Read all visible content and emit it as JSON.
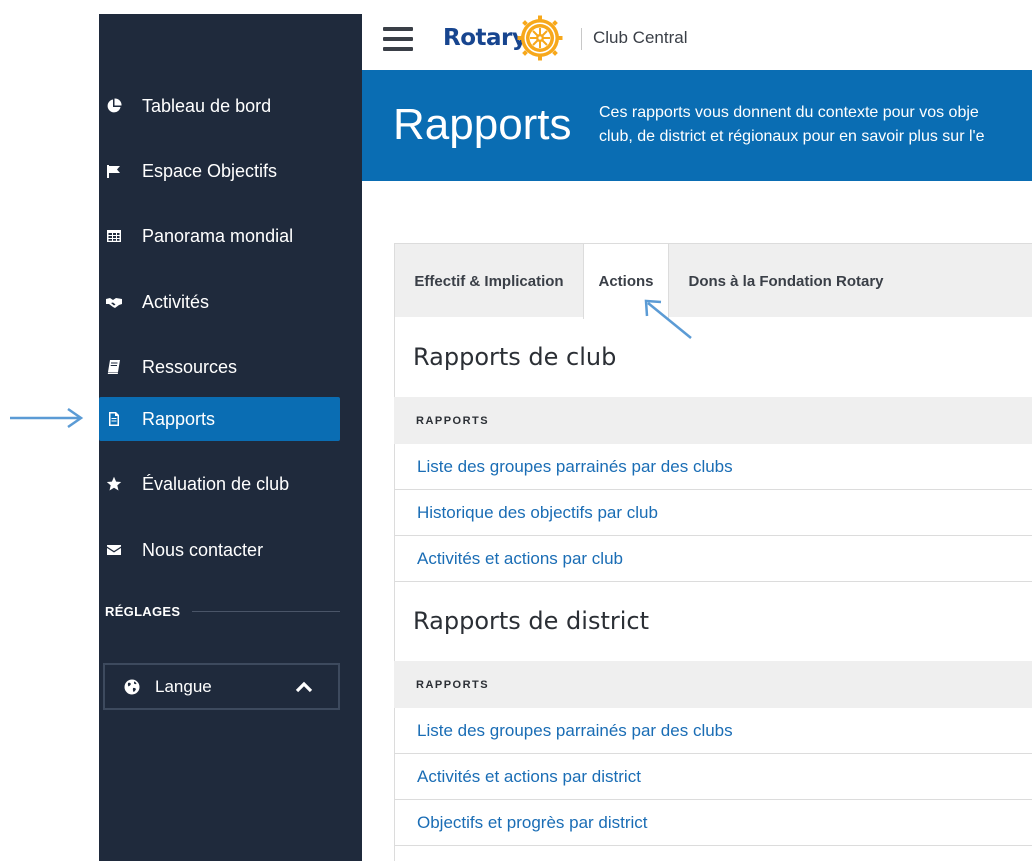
{
  "header": {
    "logo_text": "Rotary",
    "app_name": "Club Central"
  },
  "sidebar": {
    "items": [
      {
        "label": "Tableau de bord",
        "icon": "pie-chart-icon"
      },
      {
        "label": "Espace Objectifs",
        "icon": "flag-icon"
      },
      {
        "label": "Panorama mondial",
        "icon": "table-grid-icon"
      },
      {
        "label": "Activités",
        "icon": "handshake-icon"
      },
      {
        "label": "Ressources",
        "icon": "book-icon"
      },
      {
        "label": "Rapports",
        "icon": "document-icon",
        "active": true
      },
      {
        "label": "Évaluation de club",
        "icon": "star-icon"
      },
      {
        "label": "Nous contacter",
        "icon": "envelope-icon"
      }
    ],
    "settings_label": "RÉGLAGES",
    "language_label": "Langue"
  },
  "banner": {
    "title": "Rapports",
    "description_line1": "Ces rapports vous donnent du contexte pour vos obje",
    "description_line2": "club, de district et régionaux pour en savoir plus sur l'e"
  },
  "tabs": [
    {
      "label": "Effectif & Implication",
      "active": false
    },
    {
      "label": "Actions",
      "active": true
    },
    {
      "label": "Dons à la Fondation Rotary",
      "active": false
    }
  ],
  "sections": [
    {
      "title": "Rapports de club",
      "column_header": "RAPPORTS",
      "rows": [
        "Liste des groupes parrainés par des clubs",
        "Historique des objectifs par club",
        "Activités et actions par club"
      ]
    },
    {
      "title": "Rapports de district",
      "column_header": "RAPPORTS",
      "rows": [
        "Liste des groupes parrainés par des clubs",
        "Activités et actions par district",
        "Objectifs et progrès par district"
      ]
    }
  ],
  "colors": {
    "sidebar_bg": "#1f2a3c",
    "accent_blue": "#0a6db3",
    "link_blue": "#1a6db5",
    "rotary_blue": "#17458f",
    "rotary_gold": "#f7a81b",
    "annotation_arrow": "#5b9bd5"
  }
}
